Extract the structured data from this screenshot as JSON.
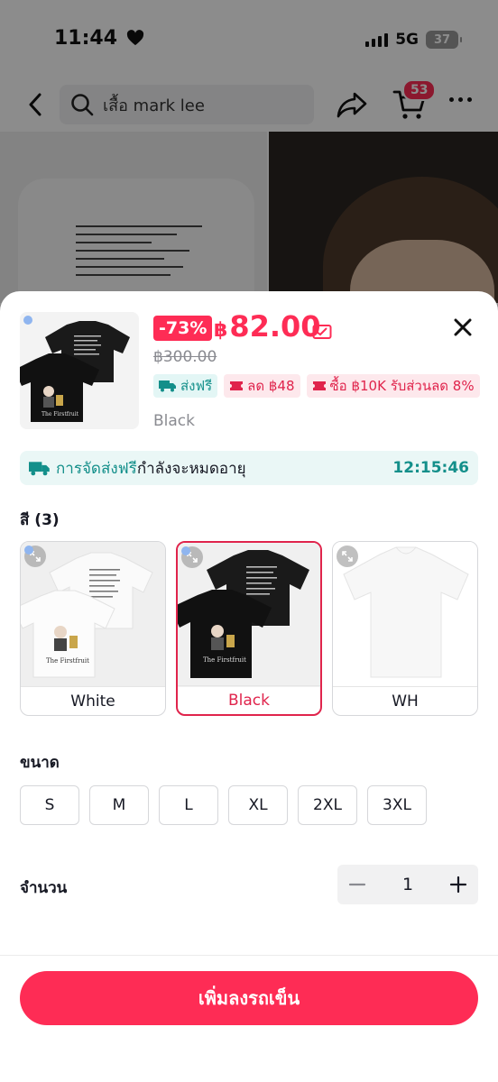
{
  "status_bar": {
    "time": "11:44",
    "network": "5G",
    "battery": "37"
  },
  "nav": {
    "search_text": "เสื้อ mark lee",
    "cart_count": "53"
  },
  "product": {
    "discount": "-73%",
    "currency": "฿",
    "price": "82.00",
    "original_price": "฿300.00",
    "selected_variant": "Black",
    "tags": {
      "free_shipping": "ส่งฟรี",
      "coupon_1": "ลด ฿48",
      "coupon_2": "ซื้อ ฿10K รับส่วนลด 8%"
    }
  },
  "shipping_banner": {
    "text_highlight": "การจัดส่งฟรี",
    "text_rest": "กำลังจะหมดอายุ",
    "timer": "12:15:46"
  },
  "color_section": {
    "label": "สี (3)",
    "options": [
      {
        "label": "White",
        "selected": false
      },
      {
        "label": "Black",
        "selected": true
      },
      {
        "label": "WH",
        "selected": false
      }
    ]
  },
  "size_section": {
    "label": "ขนาด",
    "options": [
      "S",
      "M",
      "L",
      "XL",
      "2XL",
      "3XL"
    ]
  },
  "quantity": {
    "label": "จำนวน",
    "value": "1"
  },
  "add_to_cart": "เพิ่มลงรถเข็น",
  "colors": {
    "accent": "#fe2c55",
    "teal": "#138f8a",
    "ship_bg": "#eaf7f6",
    "coupon_bg": "#fde8ec"
  },
  "icons": [
    "heart-icon",
    "back-arrow-icon",
    "search-icon",
    "share-icon",
    "cart-icon",
    "more-icon",
    "coupon-icon",
    "close-icon",
    "truck-icon",
    "ticket-icon",
    "expand-icon",
    "minus-icon",
    "plus-icon"
  ]
}
